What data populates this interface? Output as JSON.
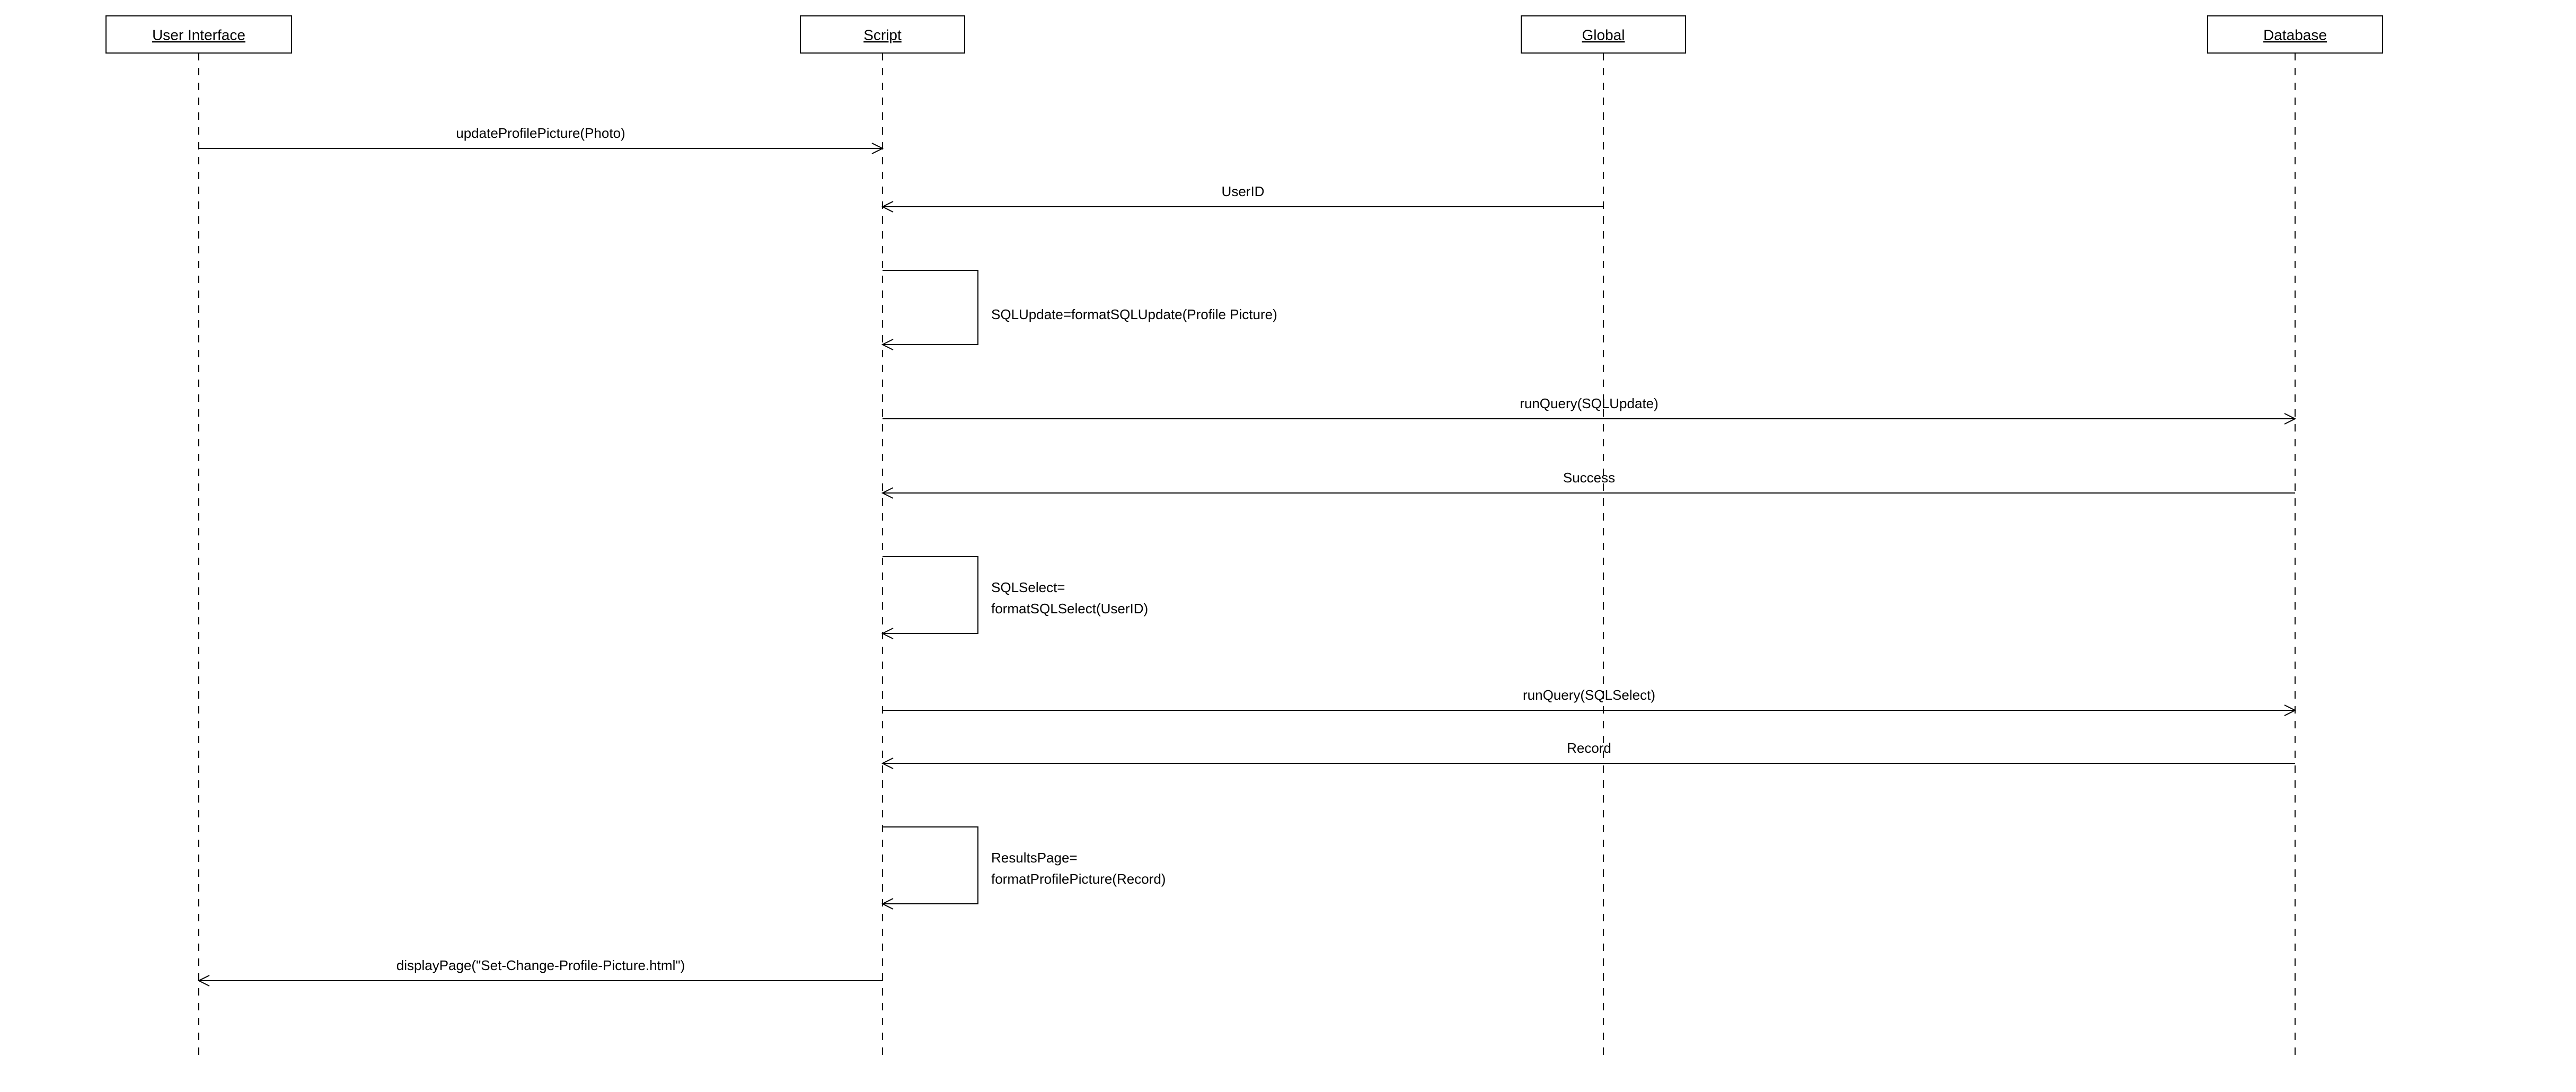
{
  "diagram_type": "UML Sequence Diagram",
  "participants": {
    "ui": "User Interface",
    "script": "Script",
    "global": "Global",
    "database": "Database"
  },
  "messages": {
    "m1": "updateProfilePicture(Photo)",
    "m2": "UserID",
    "m3": "SQLUpdate=formatSQLUpdate(Profile Picture)",
    "m4": "runQuery(SQLUpdate)",
    "m5": "Success",
    "m6a": "SQLSelect=",
    "m6b": "formatSQLSelect(UserID)",
    "m7": "runQuery(SQLSelect)",
    "m8": "Record",
    "m9a": "ResultsPage=",
    "m9b": "formatProfilePicture(Record)",
    "m10": "displayPage(\"Set-Change-Profile-Picture.html\")"
  }
}
